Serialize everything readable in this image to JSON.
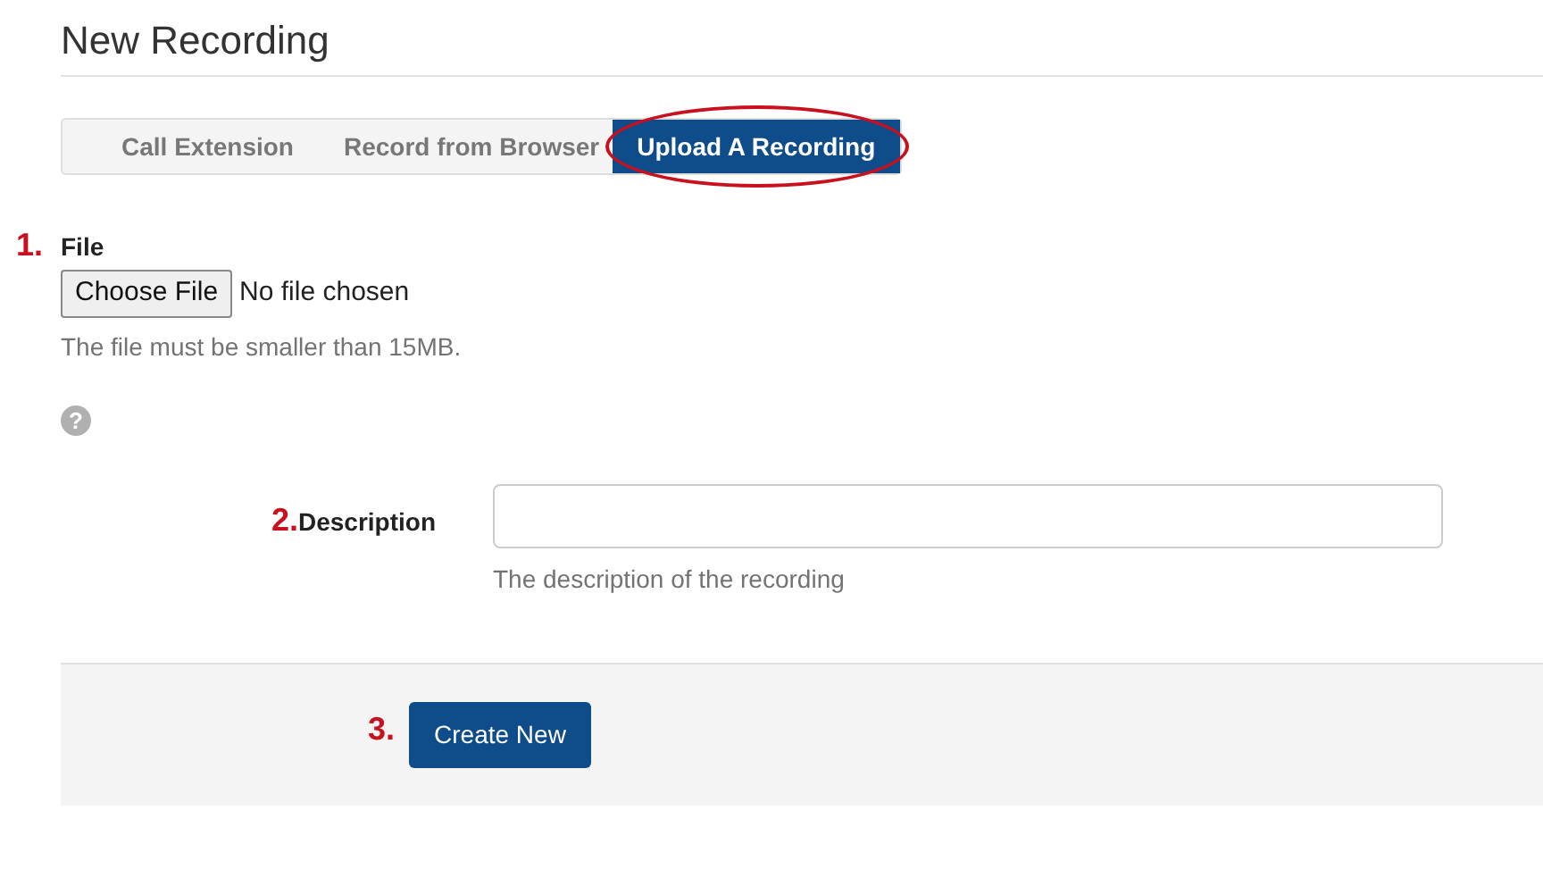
{
  "title": "New Recording",
  "tabs": [
    {
      "label": "Call Extension",
      "selected": false
    },
    {
      "label": "Record from Browser",
      "selected": false
    },
    {
      "label": "Upload A Recording",
      "selected": true,
      "circled": true
    }
  ],
  "file_field": {
    "step": "1.",
    "label": "File",
    "button": "Choose File",
    "value": "No file chosen",
    "help": "The file must be smaller than 15MB."
  },
  "help_icon": "?",
  "description_field": {
    "step": "2.",
    "label": "Description",
    "help": "The description of the recording"
  },
  "submit": {
    "step": "3.",
    "label": "Create New"
  }
}
